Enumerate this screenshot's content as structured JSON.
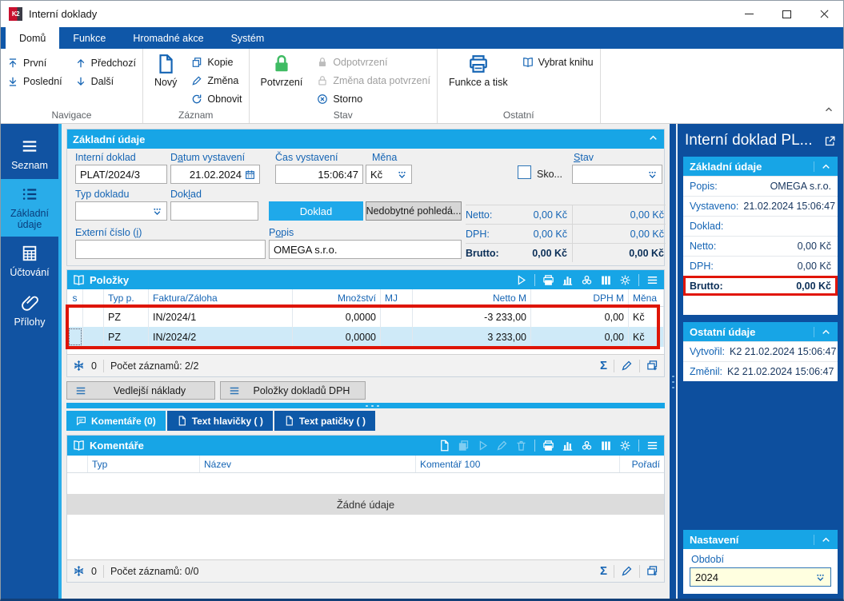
{
  "window": {
    "logo": "K2",
    "title": "Interní doklady"
  },
  "colors": {
    "accent_cyan": "#17A5E6",
    "dark_blue": "#0D4F9E",
    "label_blue": "#1464B4",
    "annotation_red": "#DE1507",
    "confirm_green": "#3FBB63",
    "selection_blue": "#CFEAF8",
    "input_yellow": "#FFFFE0"
  },
  "icons": {
    "sum": "Σ"
  },
  "ribbon": {
    "tabs": [
      {
        "label": "Domů",
        "active": true
      },
      {
        "label": "Funkce",
        "active": false
      },
      {
        "label": "Hromadné akce",
        "active": false
      },
      {
        "label": "Systém",
        "active": false
      }
    ],
    "navigace": {
      "label": "Navigace",
      "first": "První",
      "last": "Poslední",
      "prev": "Předchozí",
      "next": "Další"
    },
    "zaznam": {
      "label": "Záznam",
      "new": "Nový",
      "copy": "Kopie",
      "change": "Změna",
      "refresh": "Obnovit"
    },
    "stav": {
      "label": "Stav",
      "confirm": "Potvrzení",
      "unconfirm": "Odpotvrzení",
      "change_date": "Změna data potvrzení",
      "cancel": "Storno"
    },
    "ostatni": {
      "label": "Ostatní",
      "functions_print": "Funkce a tisk",
      "select_book": "Vybrat knihu"
    }
  },
  "sidebar": {
    "items": [
      {
        "label": "Seznam",
        "active": false
      },
      {
        "label": "Základní údaje",
        "active": true
      },
      {
        "label": "Účtování",
        "active": false
      },
      {
        "label": "Přílohy",
        "active": false
      }
    ]
  },
  "form": {
    "title": "Základní údaje",
    "interni": {
      "label": "Interní doklad",
      "value": "PLAT/2024/3"
    },
    "datum": {
      "pre": "D",
      "key": "a",
      "post": "tum vystavení",
      "value": "21.02.2024"
    },
    "cas": {
      "label": "Čas vystavení",
      "value": "15:06:47"
    },
    "mena": {
      "label": "Měna",
      "value": "Kč"
    },
    "sko": {
      "label": "Sko..."
    },
    "stavf": {
      "pre": "",
      "key": "S",
      "post": "tav",
      "value": ""
    },
    "typ": {
      "label": "Typ dokladu",
      "value": ""
    },
    "doklad": {
      "pre": "Dok",
      "key": "l",
      "post": "ad",
      "value": ""
    },
    "doklad_btn": "Doklad",
    "nedobytne_btn": "Nedobytné pohledá...",
    "externi": {
      "pre": "Externí číslo (",
      "key": "i",
      "post": ")",
      "value": ""
    },
    "popis": {
      "pre": "P",
      "key": "o",
      "post": "pis",
      "value": "OMEGA s.r.o."
    },
    "totals": {
      "rows": [
        {
          "label": "Netto:",
          "v1": "0,00 Kč",
          "v2": "0,00 Kč"
        },
        {
          "label": "DPH:",
          "v1": "0,00 Kč",
          "v2": "0,00 Kč"
        },
        {
          "label": "Brutto:",
          "v1": "0,00 Kč",
          "v2": "0,00 Kč"
        }
      ]
    }
  },
  "polozky": {
    "title": "Položky",
    "columns": [
      "s",
      "",
      "Typ p.",
      "Faktura/Záloha",
      "Množství",
      "MJ",
      "Netto M",
      "DPH M",
      "Měna"
    ],
    "rows": [
      {
        "typ": "PZ",
        "faktura": "IN/2024/1",
        "mnozstvi": "0,0000",
        "mj": "",
        "netto": "-3 233,00",
        "dph": "0,00",
        "mena": "Kč"
      },
      {
        "typ": "PZ",
        "faktura": "IN/2024/2",
        "mnozstvi": "0,0000",
        "mj": "",
        "netto": "3 233,00",
        "dph": "0,00",
        "mena": "Kč"
      }
    ],
    "status": {
      "frozen": "0",
      "count": "Počet záznamů: 2/2"
    }
  },
  "actions": {
    "vedlejsi": "Vedlejší náklady",
    "polozky_dph": "Položky dokladů DPH"
  },
  "doc_tabs": [
    {
      "label": "Komentáře (0)",
      "active": true
    },
    {
      "label": "Text hlavičky ( )",
      "active": false
    },
    {
      "label": "Text patičky ( )",
      "active": false
    }
  ],
  "komentare": {
    "title": "Komentáře",
    "columns": [
      "",
      "Typ",
      "Název",
      "Komentář 100",
      "Pořadí"
    ],
    "empty_text": "Žádné údaje",
    "status": {
      "frozen": "0",
      "count": "Počet záznamů: 0/0"
    }
  },
  "sidepanel": {
    "title": "Interní doklad PL...",
    "zakladni": {
      "title": "Základní údaje",
      "rows": [
        {
          "label": "Popis:",
          "value": "OMEGA s.r.o."
        },
        {
          "label": "Vystaveno:",
          "value": "21.02.2024 15:06:47"
        },
        {
          "label": "Doklad:",
          "value": ""
        },
        {
          "label": "Netto:",
          "value": "0,00 Kč"
        },
        {
          "label": "DPH:",
          "value": "0,00 Kč"
        },
        {
          "label": "Brutto:",
          "value": "0,00 Kč"
        }
      ]
    },
    "ostatni": {
      "title": "Ostatní údaje",
      "rows": [
        {
          "label": "Vytvořil:",
          "value": "K2 21.02.2024 15:06:47"
        },
        {
          "label": "Změnil:",
          "value": "K2 21.02.2024 15:06:47"
        }
      ]
    },
    "nastaveni": {
      "title": "Nastavení",
      "obdobi_label": "Období",
      "obdobi_value": "2024"
    }
  }
}
